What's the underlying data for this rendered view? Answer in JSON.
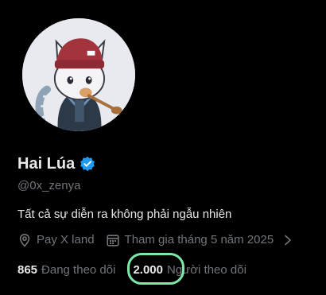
{
  "profile": {
    "display_name": "Hai Lúa",
    "handle": "@0x_zenya",
    "bio": "Tất cả sự diễn ra không phải ngẫu nhiên",
    "location": "Pay X land",
    "joined": "Tham gia tháng 5 năm 2025"
  },
  "stats": {
    "following_count": "865",
    "following_label": "Đang theo dõi",
    "followers_count": "2.000",
    "followers_label": "Người theo dõi"
  },
  "icons": {
    "verified": "verified-badge-icon",
    "location": "location-pin-icon",
    "joined": "calendar-icon",
    "more": "chevron-right-icon"
  },
  "colors": {
    "background": "#000000",
    "text_primary": "#e7e9ea",
    "text_secondary": "#71767b",
    "verified_blue": "#1d9bf0",
    "highlight": "#7de8a9"
  }
}
